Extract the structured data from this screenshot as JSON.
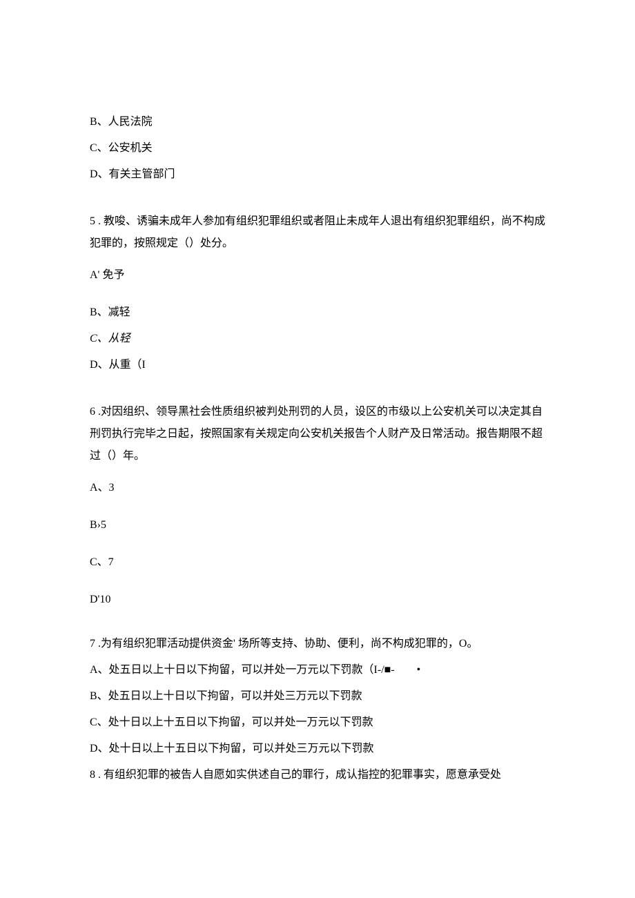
{
  "q4_options": {
    "b": "B、人民法院",
    "c": "C、公安机关",
    "d": "D、有关主管部门"
  },
  "q5": {
    "stem": "5 . 教唆、诱骗未成年人参加有组织犯罪组织或者阻止未成年人退出有组织犯罪组织，尚不构成犯罪的，按照规定（）处分。",
    "a": "A' 免予",
    "b": "B、减轻",
    "c": "C、从轻",
    "d": "D、从重（I"
  },
  "q6": {
    "stem": "6 .对因组织、领导黑社会性质组织被判处刑罚的人员，设区的市级以上公安机关可以决定其自刑罚执行完毕之日起，按照国家有关规定向公安机关报告个人财产及日常活动。报告期限不超过（）年。",
    "a": "A、3",
    "b": "B›5",
    "c": "C、7",
    "d": "D'10"
  },
  "q7": {
    "stem": "7 .为有组织犯罪活动提供资金' 场所等支持、协助、便利，尚不构成犯罪的，O。",
    "a": "A、处五日以上十日以下拘留，可以并处一万元以下罚款（I-/■-        •",
    "b": "B、处五日以上十日以下拘留，可以并处三万元以下罚款",
    "c": "C、处十日以上十五日以下拘留，可以并处一万元以下罚款",
    "d": "D、处十日以上十五日以下拘留，可以并处三万元以下罚款"
  },
  "q8": {
    "stem": "8 . 有组织犯罪的被告人自愿如实供述自己的罪行，成认指控的犯罪事实，愿意承受处"
  }
}
